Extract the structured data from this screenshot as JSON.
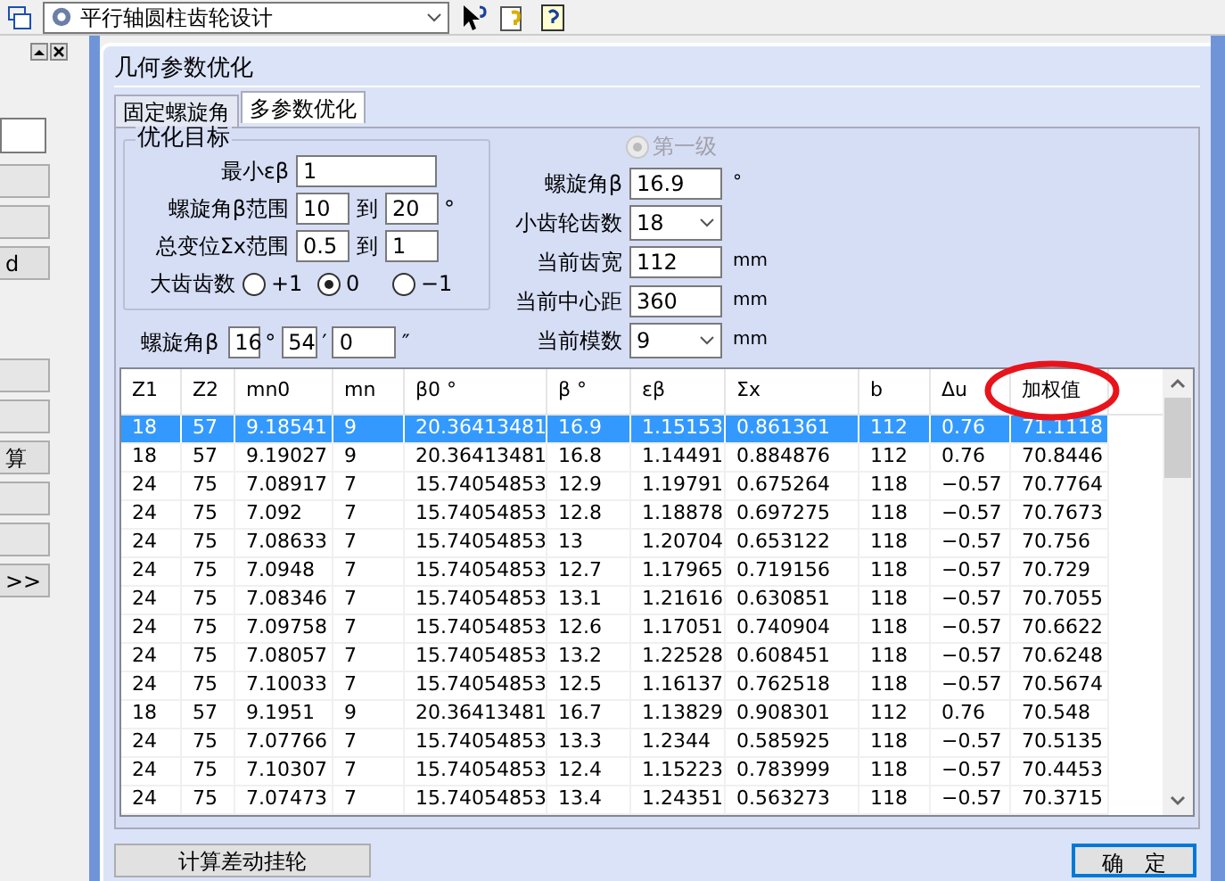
{
  "toolbar": {
    "module_select": {
      "value": "平行轴圆柱齿轮设计"
    }
  },
  "left_panel": {
    "buttons": [
      {
        "kind": "blank"
      },
      {
        "kind": "blank"
      },
      {
        "kind": "text",
        "label": "d"
      },
      {
        "kind": "blank"
      },
      {
        "kind": "blank"
      },
      {
        "kind": "text",
        "label": "算"
      },
      {
        "kind": "blank"
      },
      {
        "kind": "blank"
      },
      {
        "kind": "text",
        "label": ">>"
      }
    ]
  },
  "dialog": {
    "title": "几何参数优化",
    "tabs": [
      {
        "label": "固定螺旋角",
        "selected": false
      },
      {
        "label": "多参数优化",
        "selected": true
      }
    ],
    "target_group": {
      "title": "优化目标",
      "min_eb": {
        "label": "最小εβ",
        "value": "1"
      },
      "beta_range": {
        "label": "螺旋角β范围",
        "from": "10",
        "to_label": "到",
        "to": "20",
        "unit": "°"
      },
      "sx_range": {
        "label": "总变位Σx范围",
        "from": "0.5",
        "to_label": "到",
        "to": "1"
      },
      "big_teeth": {
        "label": "大齿齿数",
        "options": [
          {
            "label": "+1",
            "selected": false
          },
          {
            "label": "0",
            "selected": true
          },
          {
            "label": "−1",
            "selected": false
          }
        ]
      }
    },
    "helix": {
      "label": "螺旋角β",
      "deg": "16",
      "deg_unit": "°",
      "min": "54",
      "min_unit": "′",
      "sec": "0",
      "sec_unit": "″"
    },
    "stage_radio": {
      "label": "第一级",
      "selected": true,
      "disabled": true
    },
    "params": [
      {
        "kind": "text",
        "label": "螺旋角β",
        "value": "16.9",
        "unit": "°"
      },
      {
        "kind": "combo",
        "label": "小齿轮齿数",
        "value": "18"
      },
      {
        "kind": "text",
        "label": "当前齿宽",
        "value": "112",
        "unit": "mm"
      },
      {
        "kind": "text",
        "label": "当前中心距",
        "value": "360",
        "unit": "mm"
      },
      {
        "kind": "combo",
        "label": "当前模数",
        "value": "9",
        "unit": "mm"
      }
    ],
    "table": {
      "columns": [
        "Z1",
        "Z2",
        "mn0",
        "mn",
        "β0 °",
        "β °",
        "εβ",
        "Σx",
        "b",
        "Δu",
        "加权值"
      ],
      "rows": [
        {
          "selected": true,
          "cells": [
            "18",
            "57",
            "9.18541",
            "9",
            "20.36413481",
            "16.9",
            "1.15153",
            "0.861361",
            "112",
            "0.76",
            "71.1118"
          ]
        },
        {
          "selected": false,
          "cells": [
            "18",
            "57",
            "9.19027",
            "9",
            "20.36413481",
            "16.8",
            "1.14491",
            "0.884876",
            "112",
            "0.76",
            "70.8446"
          ]
        },
        {
          "selected": false,
          "cells": [
            "24",
            "75",
            "7.08917",
            "7",
            "15.74054853",
            "12.9",
            "1.19791",
            "0.675264",
            "118",
            "−0.57",
            "70.7764"
          ]
        },
        {
          "selected": false,
          "cells": [
            "24",
            "75",
            "7.092",
            "7",
            "15.74054853",
            "12.8",
            "1.18878",
            "0.697275",
            "118",
            "−0.57",
            "70.7673"
          ]
        },
        {
          "selected": false,
          "cells": [
            "24",
            "75",
            "7.08633",
            "7",
            "15.74054853",
            "13",
            "1.20704",
            "0.653122",
            "118",
            "−0.57",
            "70.756"
          ]
        },
        {
          "selected": false,
          "cells": [
            "24",
            "75",
            "7.0948",
            "7",
            "15.74054853",
            "12.7",
            "1.17965",
            "0.719156",
            "118",
            "−0.57",
            "70.729"
          ]
        },
        {
          "selected": false,
          "cells": [
            "24",
            "75",
            "7.08346",
            "7",
            "15.74054853",
            "13.1",
            "1.21616",
            "0.630851",
            "118",
            "−0.57",
            "70.7055"
          ]
        },
        {
          "selected": false,
          "cells": [
            "24",
            "75",
            "7.09758",
            "7",
            "15.74054853",
            "12.6",
            "1.17051",
            "0.740904",
            "118",
            "−0.57",
            "70.6622"
          ]
        },
        {
          "selected": false,
          "cells": [
            "24",
            "75",
            "7.08057",
            "7",
            "15.74054853",
            "13.2",
            "1.22528",
            "0.608451",
            "118",
            "−0.57",
            "70.6248"
          ]
        },
        {
          "selected": false,
          "cells": [
            "24",
            "75",
            "7.10033",
            "7",
            "15.74054853",
            "12.5",
            "1.16137",
            "0.762518",
            "118",
            "−0.57",
            "70.5674"
          ]
        },
        {
          "selected": false,
          "cells": [
            "18",
            "57",
            "9.1951",
            "9",
            "20.36413481",
            "16.7",
            "1.13829",
            "0.908301",
            "112",
            "0.76",
            "70.548"
          ]
        },
        {
          "selected": false,
          "cells": [
            "24",
            "75",
            "7.07766",
            "7",
            "15.74054853",
            "13.3",
            "1.2344",
            "0.585925",
            "118",
            "−0.57",
            "70.5135"
          ]
        },
        {
          "selected": false,
          "cells": [
            "24",
            "75",
            "7.10307",
            "7",
            "15.74054853",
            "12.4",
            "1.15223",
            "0.783999",
            "118",
            "−0.57",
            "70.4453"
          ]
        },
        {
          "selected": false,
          "cells": [
            "24",
            "75",
            "7.07473",
            "7",
            "15.74054853",
            "13.4",
            "1.24351",
            "0.563273",
            "118",
            "−0.57",
            "70.3715"
          ]
        }
      ]
    },
    "buttons": [
      {
        "label": "计算差动挂轮",
        "focused": false
      },
      {
        "label": "确　定",
        "focused": true
      }
    ]
  }
}
